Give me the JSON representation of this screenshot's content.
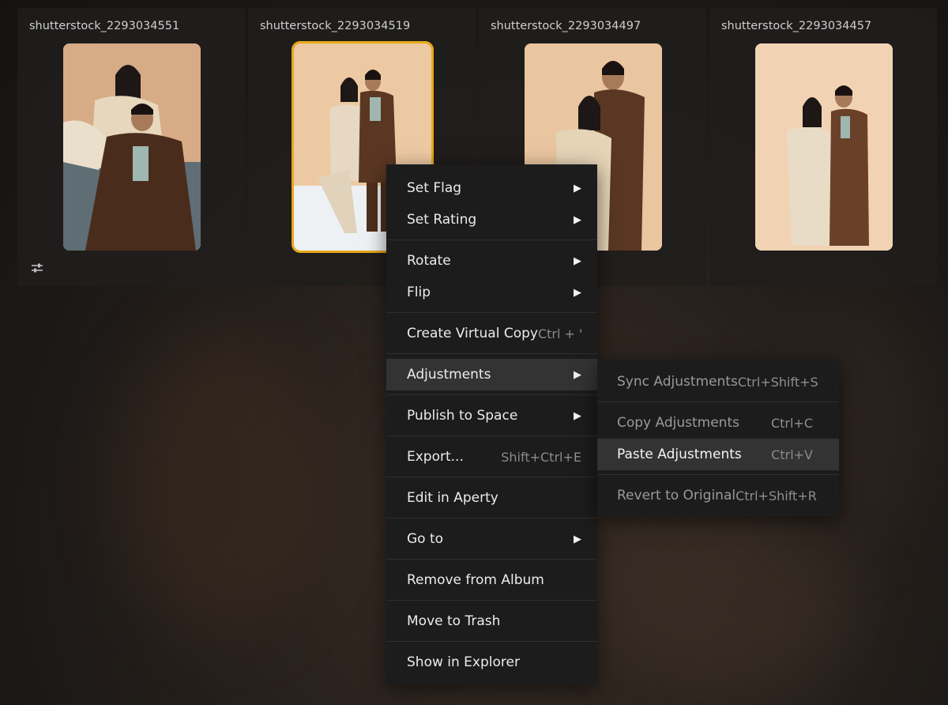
{
  "colors": {
    "selection": "#e8a81a",
    "menu_bg": "#1c1c1c",
    "menu_highlight": "#333333"
  },
  "thumbnails": [
    {
      "title": "shutterstock_2293034551",
      "selected": false,
      "has_adjustments": true
    },
    {
      "title": "shutterstock_2293034519",
      "selected": true,
      "has_adjustments": false
    },
    {
      "title": "shutterstock_2293034497",
      "selected": false,
      "has_adjustments": false
    },
    {
      "title": "shutterstock_2293034457",
      "selected": false,
      "has_adjustments": false
    }
  ],
  "context_menu": {
    "set_flag": "Set Flag",
    "set_rating": "Set Rating",
    "rotate": "Rotate",
    "flip": "Flip",
    "create_virtual_copy": "Create Virtual Copy",
    "create_virtual_copy_shortcut": "Ctrl + '",
    "adjustments": "Adjustments",
    "publish_to_space": "Publish to Space",
    "export": "Export...",
    "export_shortcut": "Shift+Ctrl+E",
    "edit_in_aperty": "Edit in Aperty",
    "go_to": "Go to",
    "remove_from_album": "Remove from Album",
    "move_to_trash": "Move to Trash",
    "show_in_explorer": "Show in Explorer",
    "arrow": "▶"
  },
  "adjustments_submenu": {
    "sync": "Sync Adjustments",
    "sync_shortcut": "Ctrl+Shift+S",
    "copy": "Copy Adjustments",
    "copy_shortcut": "Ctrl+C",
    "paste": "Paste Adjustments",
    "paste_shortcut": "Ctrl+V",
    "revert": "Revert to Original",
    "revert_shortcut": "Ctrl+Shift+R"
  }
}
